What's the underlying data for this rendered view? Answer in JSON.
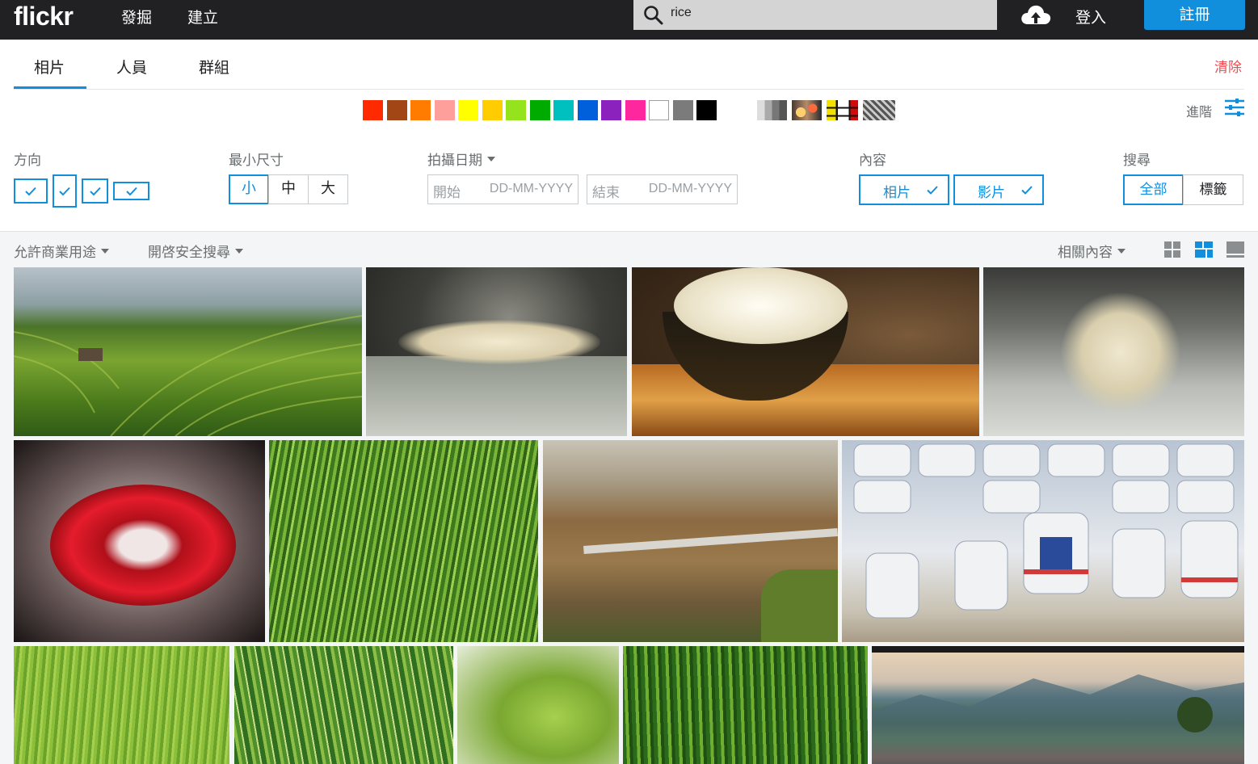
{
  "header": {
    "logo": "flickr",
    "nav": [
      "發掘",
      "建立"
    ],
    "search_value": "rice",
    "login": "登入",
    "signup": "註冊"
  },
  "tabs": [
    "相片",
    "人員",
    "群組"
  ],
  "clear_label": "清除",
  "advanced_label": "進階",
  "colors": [
    "#ff2a00",
    "#a24615",
    "#ff7c00",
    "#ff9f9c",
    "#ffff00",
    "#ffcc00",
    "#95e31c",
    "#00ab00",
    "#00bfbf",
    "#005fdb",
    "#8c22be",
    "#ff279d",
    "#ffffff",
    "#7b7b7b",
    "#000000"
  ],
  "style_swatches": [
    "black-and-white-icon",
    "shallow-depth-of-field-icon",
    "minimalism-icon",
    "patterns-icon"
  ],
  "filters": {
    "orientation_label": "方向",
    "min_size_label": "最小尺寸",
    "sizes": [
      "小",
      "中",
      "大"
    ],
    "date_label": "拍攝日期",
    "date_start_label": "開始",
    "date_end_label": "結束",
    "date_placeholder": "DD-MM-YYYY",
    "content_label": "內容",
    "content_options": [
      "相片",
      "影片"
    ],
    "search_label": "搜尋",
    "search_options": [
      "全部",
      "標籤"
    ]
  },
  "subbar": {
    "license": "允許商業用途",
    "safe_search": "開啓安全搜尋",
    "sort": "相關內容"
  },
  "photos": [
    "rice-terraces-photo",
    "rice-grains-photo",
    "rice-bowl-photo",
    "rice-grains-marble-photo",
    "red-lips-rice-photo",
    "rice-plants-photo",
    "roadside-harvest-photo",
    "rice-sacks-photo",
    "rice-field-photo",
    "rice-stalks-photo",
    "rice-ear-closeup-photo",
    "rice-grass-photo",
    "mountain-valley-photo"
  ]
}
